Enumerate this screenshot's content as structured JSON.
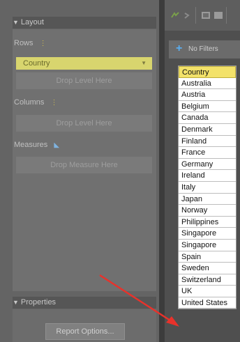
{
  "layout": {
    "title": "Layout",
    "rows_label": "Rows",
    "row_field": "Country",
    "drop_level": "Drop Level Here",
    "columns_label": "Columns",
    "measures_label": "Measures",
    "drop_measure": "Drop Measure Here"
  },
  "properties": {
    "title": "Properties",
    "report_options": "Report Options..."
  },
  "filters": {
    "label": "No Filters"
  },
  "countries": {
    "header": "Country",
    "items": [
      "Australia",
      "Austria",
      "Belgium",
      "Canada",
      "Denmark",
      "Finland",
      "France",
      "Germany",
      "Ireland",
      "Italy",
      "Japan",
      "Norway",
      "Philippines",
      "Singapore",
      "Singapore",
      "Spain",
      "Sweden",
      "Switzerland",
      "UK",
      "United States"
    ]
  },
  "colors": {
    "arrow": "#e8322b",
    "chip": "#d8d56e",
    "list_header": "#f3e26a",
    "plus": "#5aaef0"
  }
}
